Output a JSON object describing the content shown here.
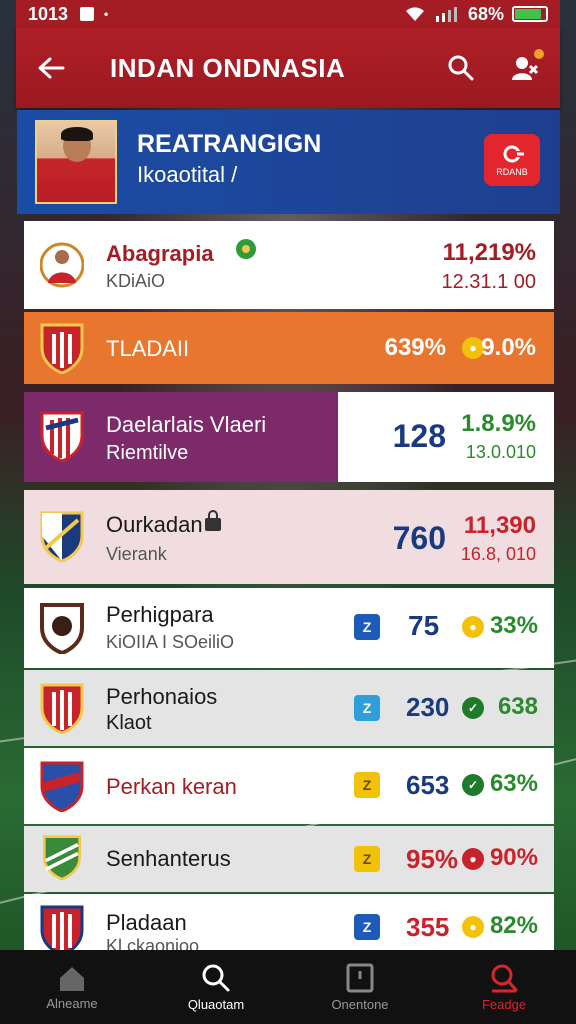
{
  "status": {
    "time": "1013",
    "battery": "68%"
  },
  "header": {
    "title": "INDAN ONDNASIA"
  },
  "hero": {
    "name": "REATRANGIGN",
    "subtitle": "Ikoaotital /",
    "live_label": "RDANB"
  },
  "rows": [
    {
      "title": "Abagrapia",
      "subtitle": "KDiAiO",
      "top": "11,219%",
      "bottom": "12.31.1 00"
    },
    {
      "title": "TLADAII",
      "value": "639%",
      "pct": "9.0%"
    },
    {
      "title": "Daelarlais Vlaeri",
      "subtitle": "Riemtilve",
      "value": "128",
      "top": "1.8.9%",
      "bottom": "13.0.010"
    },
    {
      "title": "Ourkadan",
      "subtitle": "Vierank",
      "value": "760",
      "top": "11,390",
      "bottom": "16.8, 010"
    },
    {
      "title": "Perhigpara",
      "subtitle": "KiOIIA I SOeiliO",
      "badge": "Z",
      "value": "75",
      "pct": "33%"
    },
    {
      "title": "Perhonaios",
      "subtitle": "Klaot",
      "badge": "Z",
      "value": "230",
      "pct": "638"
    },
    {
      "title": "Perkan keran",
      "badge": "Z",
      "value": "653",
      "pct": "63%"
    },
    {
      "title": "Senhanterus",
      "badge": "Z",
      "value": "95%",
      "pct": "90%"
    },
    {
      "title": "Pladaan",
      "subtitle": "Kl.ckaonioo",
      "badge": "Z",
      "value": "355",
      "pct": "82%"
    }
  ],
  "nav": [
    {
      "label": "Alneame"
    },
    {
      "label": "Qluaotam"
    },
    {
      "label": "Onentone"
    },
    {
      "label": "Feadge"
    }
  ],
  "colors": {
    "primary": "#a51d24",
    "hero": "#1b4da6",
    "accent_orange": "#e8762e",
    "accent_purple": "#7d2a6a",
    "row_pink": "#f1dde0",
    "row_gray": "#e4e4e4"
  }
}
